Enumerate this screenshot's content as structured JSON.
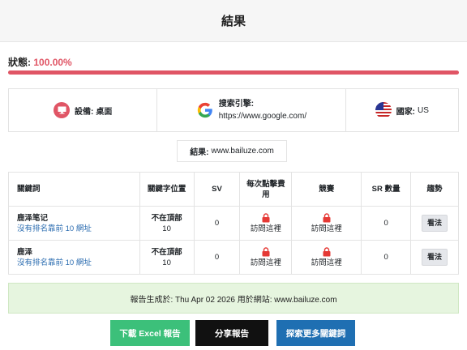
{
  "header": {
    "title": "結果"
  },
  "status": {
    "label": "狀態:",
    "value": "100.00%",
    "progress": 1.0
  },
  "info": {
    "device_label": "設備:",
    "device_value": "桌面",
    "engine_label": "搜索引擎:",
    "engine_value": "https://www.google.com/",
    "country_label": "國家:",
    "country_value": "US"
  },
  "site": {
    "label": "結果:",
    "value": "www.bailuze.com"
  },
  "table": {
    "headers": {
      "keyword": "關鍵詞",
      "position": "關鍵字位置",
      "sv": "SV",
      "cpc": "每次點擊費用",
      "competition": "競賽",
      "sr": "SR 數量",
      "trend": "趨勢"
    },
    "rows": [
      {
        "keyword": "鹿泽笔记",
        "sub": "沒有排名靠前 10 網址",
        "position_top": "不在頂部",
        "position_num": "10",
        "sv": "0",
        "cpc": "訪問這裡",
        "competition": "訪問這裡",
        "sr": "0",
        "trend": "看法"
      },
      {
        "keyword": "鹿泽",
        "sub": "沒有排名靠前 10 網址",
        "position_top": "不在頂部",
        "position_num": "10",
        "sv": "0",
        "cpc": "訪問這裡",
        "competition": "訪問這裡",
        "sr": "0",
        "trend": "看法"
      }
    ]
  },
  "report": {
    "text": "報告生成於: Thu Apr 02 2026 用於網站: www.bailuze.com"
  },
  "buttons": {
    "download": "下載 Excel 報告",
    "share": "分享報告",
    "explore": "探索更多關鍵詞"
  },
  "colors": {
    "accent_red": "#e05565",
    "green": "#3cc07a",
    "blue": "#1f6fb2",
    "dark": "#111111"
  },
  "icons": {
    "device": "desktop-icon",
    "engine": "google-icon",
    "country": "us-flag-icon",
    "lock": "lock-icon"
  }
}
